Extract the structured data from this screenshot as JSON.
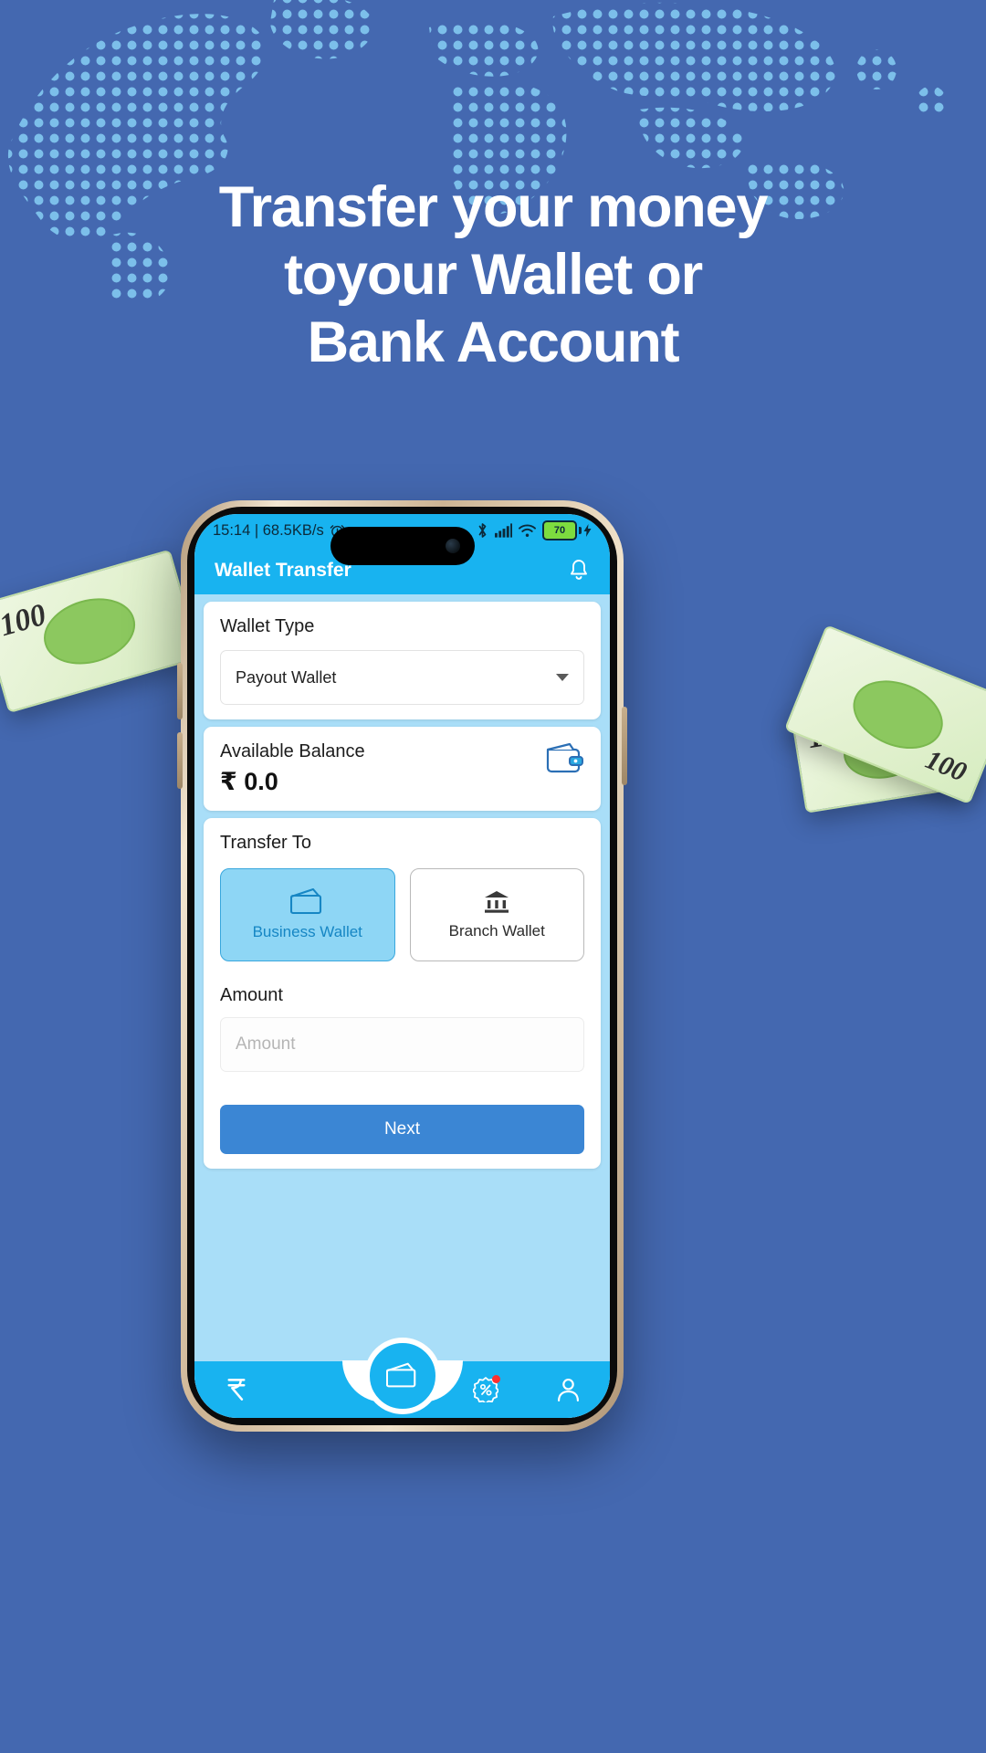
{
  "background": {
    "color": "#4468b0",
    "map_dot_color": "#7fc4ee"
  },
  "headline": {
    "line1": "Transfer your money",
    "line2": "toyour Wallet or",
    "line3": "Bank Account",
    "color": "#ffffff"
  },
  "money_notes": [
    {
      "denomination": "100",
      "name": "note-left"
    },
    {
      "denomination": "100",
      "name": "note-right"
    },
    {
      "denomination": "100",
      "name": "note-right-back"
    }
  ],
  "phone": {
    "status_bar": {
      "time_and_speed": "15:14 | 68.5KB/s",
      "alarm_icon": "alarm-clock-icon",
      "bluetooth_icon": "bluetooth-icon",
      "signal_icon": "cellular-signal-icon",
      "wifi_icon": "wifi-icon",
      "battery_level": "70",
      "battery_charging": true
    },
    "app_bar": {
      "title": "Wallet Transfer",
      "notification_icon": "bell-icon"
    },
    "wallet_type_card": {
      "label": "Wallet Type",
      "selected_value": "Payout Wallet",
      "options": [
        "Payout Wallet"
      ]
    },
    "balance_card": {
      "label": "Available Balance",
      "amount": "₹ 0.0",
      "icon": "wallet-icon"
    },
    "transfer_card": {
      "label": "Transfer To",
      "options": [
        {
          "label": "Business Wallet",
          "icon": "wallet-icon",
          "selected": true
        },
        {
          "label": "Branch Wallet",
          "icon": "bank-icon",
          "selected": false
        }
      ],
      "amount_label": "Amount",
      "amount_value": "",
      "amount_placeholder": "Amount",
      "submit_label": "Next"
    },
    "bottom_nav": [
      {
        "name": "rupee",
        "icon": "rupee-icon"
      },
      {
        "name": "wallet-fab",
        "icon": "wallet-icon"
      },
      {
        "name": "home",
        "icon": "home-icon"
      },
      {
        "name": "offers",
        "icon": "percent-badge-icon",
        "has_badge": true
      },
      {
        "name": "profile",
        "icon": "person-icon"
      }
    ]
  },
  "colors": {
    "app_accent": "#18b3f0",
    "app_body": "#a9def8",
    "primary_button": "#3b86d4",
    "selected_option_bg": "#8ed6f5",
    "selected_option_text": "#1686c4",
    "badge_red": "#ff2f2f",
    "battery_green": "#7ddc3f"
  }
}
